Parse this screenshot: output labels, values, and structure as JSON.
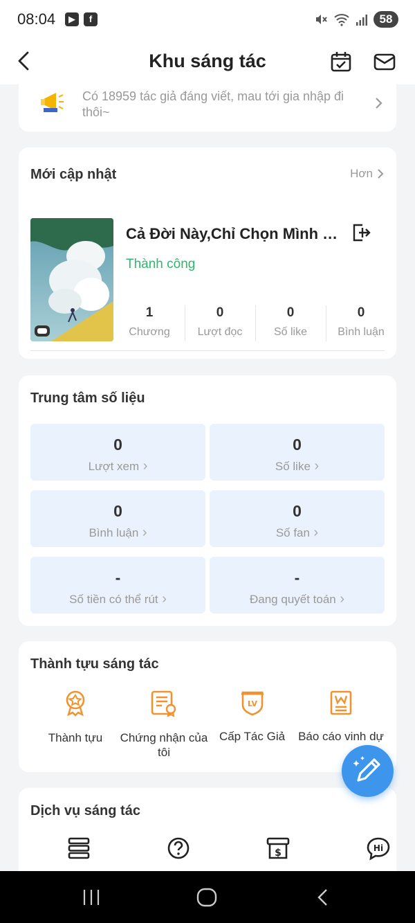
{
  "status_bar": {
    "time": "08:04",
    "battery": "58"
  },
  "header": {
    "title": "Khu sáng tác"
  },
  "banner": {
    "text": "Có 18959 tác giả đáng viết, mau tới gia nhập đi thôi~"
  },
  "recent": {
    "title": "Mới cập nhật",
    "more_label": "Hơn",
    "book": {
      "title": "Cả Đời Này,Chỉ Chọn Mình Cậu[...",
      "status": "Thành công",
      "stats": [
        {
          "value": "1",
          "label": "Chương"
        },
        {
          "value": "0",
          "label": "Lượt đọc"
        },
        {
          "value": "0",
          "label": "Số like"
        },
        {
          "value": "0",
          "label": "Bình luận"
        }
      ]
    }
  },
  "data_center": {
    "title": "Trung tâm số liệu",
    "tiles": [
      {
        "value": "0",
        "label": "Lượt xem"
      },
      {
        "value": "0",
        "label": "Số like"
      },
      {
        "value": "0",
        "label": "Bình luận"
      },
      {
        "value": "0",
        "label": "Số fan"
      },
      {
        "value": "-",
        "label": "Số tiền có thể rút"
      },
      {
        "value": "-",
        "label": "Đang quyết toán"
      }
    ]
  },
  "achievements": {
    "title": "Thành tựu sáng tác",
    "items": [
      {
        "label": "Thành tựu",
        "icon": "medal-icon"
      },
      {
        "label": "Chứng nhận của tôi",
        "icon": "certificate-icon"
      },
      {
        "label": "Cấp Tác Giả",
        "icon": "level-badge-icon"
      },
      {
        "label": "Báo cáo vinh dự",
        "icon": "honor-report-icon"
      }
    ]
  },
  "services": {
    "title": "Dịch vụ sáng tác",
    "icons": [
      "stack-icon",
      "help-icon",
      "income-icon",
      "hi-chat-icon"
    ]
  },
  "colors": {
    "accent": "#3d95ec",
    "success": "#2fb86a",
    "achievement": "#f0932e",
    "tile_bg": "#eaf3fd"
  }
}
